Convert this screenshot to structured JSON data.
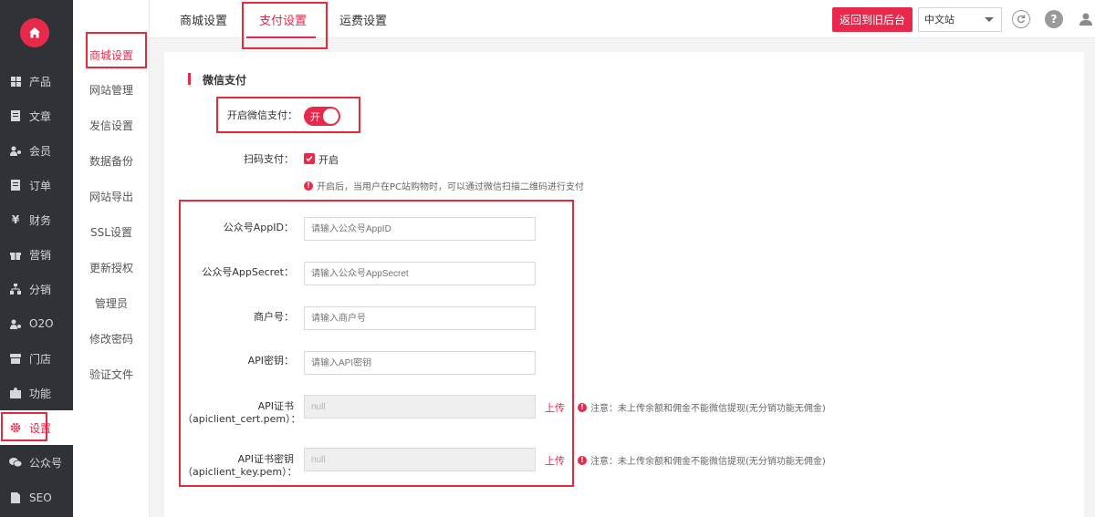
{
  "sidebar": {
    "items": [
      {
        "label": "产品",
        "icon": "grid-icon"
      },
      {
        "label": "文章",
        "icon": "document-icon"
      },
      {
        "label": "会员",
        "icon": "users-icon"
      },
      {
        "label": "订单",
        "icon": "order-icon"
      },
      {
        "label": "财务",
        "icon": "yen-icon"
      },
      {
        "label": "营销",
        "icon": "gift-icon"
      },
      {
        "label": "分销",
        "icon": "sitemap-icon"
      },
      {
        "label": "O2O",
        "icon": "o2o-icon"
      },
      {
        "label": "门店",
        "icon": "store-icon"
      },
      {
        "label": "功能",
        "icon": "puzzle-icon"
      },
      {
        "label": "设置",
        "icon": "gear-icon"
      },
      {
        "label": "公众号",
        "icon": "wechat-icon"
      },
      {
        "label": "SEO",
        "icon": "file-icon"
      }
    ]
  },
  "subnav": {
    "items": [
      "商城设置",
      "网站管理",
      "发信设置",
      "数据备份",
      "网站导出",
      "SSL设置",
      "更新授权",
      "管理员",
      "修改密码",
      "验证文件"
    ]
  },
  "tabs": [
    "商城设置",
    "支付设置",
    "运费设置"
  ],
  "header": {
    "back_label": "返回到旧后台",
    "language": "中文站"
  },
  "section": {
    "title": "微信支付"
  },
  "form": {
    "enable_label": "开启微信支付：",
    "toggle_text": "开",
    "scan_label": "扫码支付：",
    "scan_checkbox_label": "开启",
    "scan_hint": "开启后，当用户在PC站购物时，可以通过微信扫描二维码进行支付",
    "appid_label": "公众号AppID：",
    "appid_placeholder": "请输入公众号AppID",
    "secret_label": "公众号AppSecret：",
    "secret_placeholder": "请输入公众号AppSecret",
    "merchant_label": "商户号：",
    "merchant_placeholder": "请输入商户号",
    "apikey_label": "API密钥：",
    "apikey_placeholder": "请输入API密钥",
    "cert_label_1": "API证书",
    "cert_label_2": "（apiclient_cert.pem）：",
    "cert_value": "null",
    "key_label_1": "API证书密钥",
    "key_label_2": "（apiclient_key.pem）：",
    "key_value": "null",
    "upload_label": "上传",
    "note": "注意：未上传余额和佣金不能微信提现(无分销功能无佣金)"
  },
  "colors": {
    "accent": "#e8294c",
    "sidebar_bg": "#2f3338"
  }
}
